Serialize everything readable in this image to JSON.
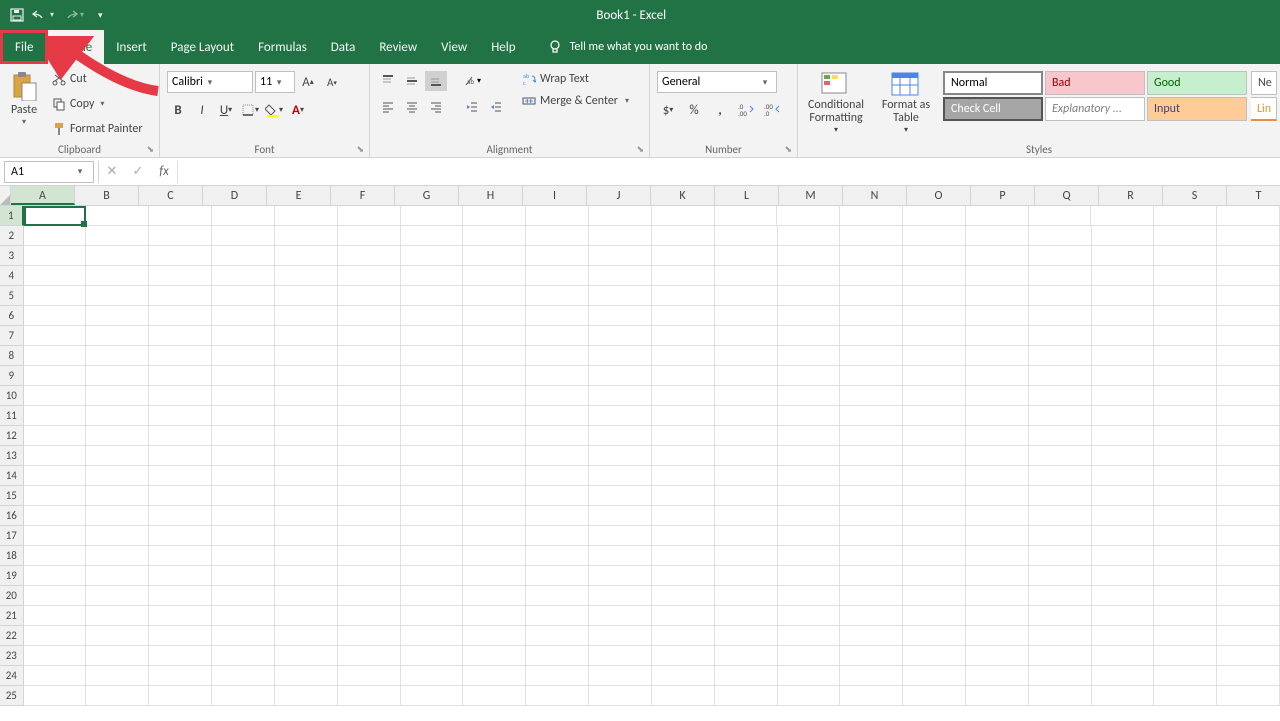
{
  "title": "Book1  -  Excel",
  "tabs": {
    "file": "File",
    "home": "Home",
    "insert": "Insert",
    "pagelayout": "Page Layout",
    "formulas": "Formulas",
    "data": "Data",
    "review": "Review",
    "view": "View",
    "help": "Help"
  },
  "tellme": "Tell me what you want to do",
  "clipboard": {
    "paste": "Paste",
    "cut": "Cut",
    "copy": "Copy",
    "formatpainter": "Format Painter",
    "label": "Clipboard"
  },
  "font": {
    "name": "Calibri",
    "size": "11",
    "label": "Font"
  },
  "alignment": {
    "wraptext": "Wrap Text",
    "mergecenter": "Merge & Center",
    "label": "Alignment"
  },
  "number": {
    "format": "General",
    "label": "Number"
  },
  "styles": {
    "conditional": "Conditional Formatting",
    "formatas": "Format as Table",
    "normal": "Normal",
    "bad": "Bad",
    "good": "Good",
    "check": "Check Cell",
    "explan": "Explanatory ...",
    "input": "Input",
    "ne": "Ne",
    "lin": "Lin",
    "label": "Styles"
  },
  "namebox": "A1",
  "columns": [
    "A",
    "B",
    "C",
    "D",
    "E",
    "F",
    "G",
    "H",
    "I",
    "J",
    "K",
    "L",
    "M",
    "N",
    "O",
    "P",
    "Q",
    "R",
    "S",
    "T"
  ],
  "rows": [
    1,
    2,
    3,
    4,
    5,
    6,
    7,
    8,
    9,
    10,
    11,
    12,
    13,
    14,
    15,
    16,
    17,
    18,
    19,
    20,
    21,
    22,
    23,
    24,
    25
  ]
}
